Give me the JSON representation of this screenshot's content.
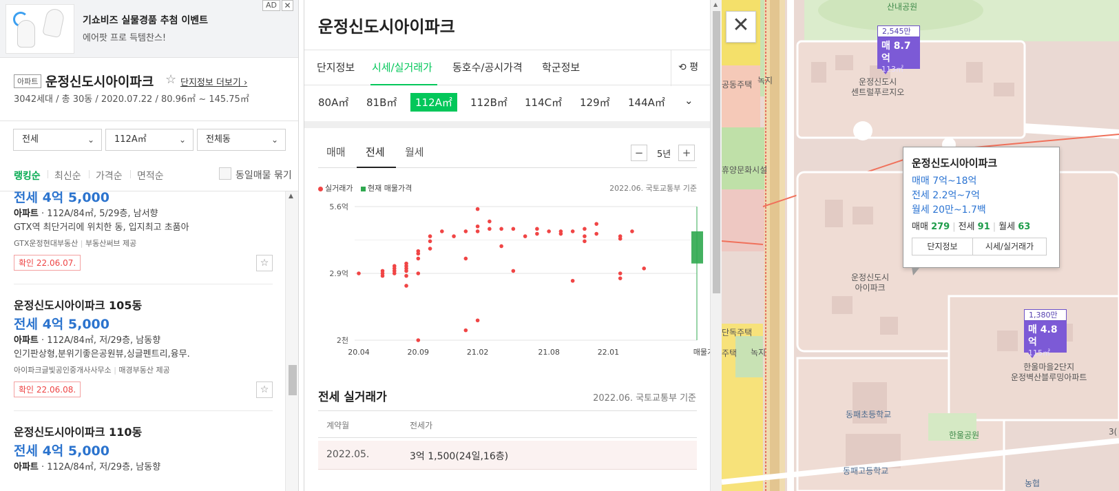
{
  "ad": {
    "title": "기쇼비즈 실물경품 추첨 이벤트",
    "subtitle": "에어팟 프로 득템찬스!",
    "badge": "AD",
    "close": "✕"
  },
  "complex": {
    "type": "아파트",
    "name": "운정신도시아이파크",
    "more_link": "단지정보 더보기",
    "meta": "3042세대 / 총 30동 / 2020.07.22 / 80.96㎡ ~ 145.75㎡"
  },
  "filters": {
    "trade": "전세",
    "area": "112A㎡",
    "dong": "전체동"
  },
  "sort": {
    "items": [
      "랭킹순",
      "최신순",
      "가격순",
      "면적순"
    ],
    "group_label": "동일매물 묶기"
  },
  "listings": [
    {
      "name": "",
      "price": "전세 4억 5,000",
      "type": "아파트",
      "spec": "112A/84㎡, 5/29층, 남서향",
      "desc": "GTX역 최단거리에 위치한 동, 입지최고 초품아",
      "agent": "GTX운정현대부동산",
      "provider": "부동산써브 제공",
      "confirm": "확인 22.06.07."
    },
    {
      "name": "운정신도시아이파크 105동",
      "price": "전세 4억 5,000",
      "type": "아파트",
      "spec": "112A/84㎡, 저/29층, 남동향",
      "desc": "인기판상형,분위기좋은공원뷰,싱글펜트리,융무.",
      "agent": "아이파크글빛공인중개사사무소",
      "provider": "매경부동산 제공",
      "confirm": "확인 22.06.08."
    },
    {
      "name": "운정신도시아이파크 110동",
      "price": "전세 4억 5,000",
      "type": "아파트",
      "spec": "112A/84㎡, 저/29층, 남동향"
    }
  ],
  "detail": {
    "title": "운정신도시아이파크",
    "tabs": [
      "단지정보",
      "시세/실거래가",
      "동호수/공시가격",
      "학군정보"
    ],
    "py_button": "평",
    "sizes": [
      "80A㎡",
      "81B㎡",
      "112A㎡",
      "112B㎡",
      "114C㎡",
      "129㎡",
      "144A㎡"
    ],
    "subtabs": [
      "매매",
      "전세",
      "월세"
    ],
    "period": "5년",
    "legend_actual": "실거래가",
    "legend_current": "현재 매물가격",
    "basis": "2022.06. 국토교통부 기준",
    "table_title": "전세 실거래가",
    "table_headers": [
      "계약월",
      "전세가"
    ],
    "table_rows": [
      {
        "month": "2022.05.",
        "price": "3억 1,500(24일,16층)"
      }
    ]
  },
  "chart_data": {
    "type": "scatter",
    "title": "",
    "xlabel": "",
    "ylabel": "",
    "y_tick_labels": [
      "5.6억",
      "2.9억",
      "2천"
    ],
    "y_ticks": [
      5.6,
      2.9,
      0.2
    ],
    "ylim": [
      0.2,
      5.6
    ],
    "x_tick_labels": [
      "20.04",
      "20.09",
      "21.02",
      "21.08",
      "22.01",
      "매물가격"
    ],
    "x_ticks": [
      "2020-04",
      "2020-09",
      "2021-02",
      "2021-08",
      "2022-01"
    ],
    "xlim": [
      "2020-04",
      "2022-07"
    ],
    "series": [
      {
        "name": "실거래가",
        "color": "#f04545",
        "points": [
          [
            "2020-04",
            2.9
          ],
          [
            "2020-06",
            2.9
          ],
          [
            "2020-06",
            2.8
          ],
          [
            "2020-06",
            3.0
          ],
          [
            "2020-07",
            3.0
          ],
          [
            "2020-07",
            2.9
          ],
          [
            "2020-07",
            3.2
          ],
          [
            "2020-07",
            3.1
          ],
          [
            "2020-08",
            2.8
          ],
          [
            "2020-08",
            3.0
          ],
          [
            "2020-08",
            3.3
          ],
          [
            "2020-08",
            2.4
          ],
          [
            "2020-08",
            3.1
          ],
          [
            "2020-08",
            3.2
          ],
          [
            "2020-09",
            3.5
          ],
          [
            "2020-09",
            3.7
          ],
          [
            "2020-09",
            3.8
          ],
          [
            "2020-09",
            2.9
          ],
          [
            "2020-10",
            4.2
          ],
          [
            "2020-10",
            4.4
          ],
          [
            "2020-10",
            3.9
          ],
          [
            "2020-11",
            4.6
          ],
          [
            "2020-12",
            4.4
          ],
          [
            "2021-01",
            4.6
          ],
          [
            "2021-01",
            3.5
          ],
          [
            "2021-02",
            4.8
          ],
          [
            "2021-02",
            4.6
          ],
          [
            "2021-02",
            5.5
          ],
          [
            "2021-03",
            4.7
          ],
          [
            "2021-03",
            5.0
          ],
          [
            "2021-04",
            4.7
          ],
          [
            "2021-04",
            4.0
          ],
          [
            "2021-05",
            4.7
          ],
          [
            "2021-05",
            3.0
          ],
          [
            "2021-06",
            4.4
          ],
          [
            "2021-07",
            4.7
          ],
          [
            "2021-07",
            4.5
          ],
          [
            "2021-08",
            4.6
          ],
          [
            "2021-09",
            4.6
          ],
          [
            "2021-09",
            4.5
          ],
          [
            "2021-10",
            4.6
          ],
          [
            "2021-10",
            2.6
          ],
          [
            "2021-11",
            4.7
          ],
          [
            "2021-11",
            4.4
          ],
          [
            "2021-11",
            4.2
          ],
          [
            "2021-12",
            4.5
          ],
          [
            "2021-12",
            4.9
          ],
          [
            "2022-02",
            4.4
          ],
          [
            "2022-02",
            4.3
          ],
          [
            "2022-02",
            2.9
          ],
          [
            "2022-02",
            2.7
          ],
          [
            "2022-03",
            4.6
          ],
          [
            "2022-04",
            3.1
          ],
          [
            "2020-09",
            0.2
          ],
          [
            "2021-01",
            0.6
          ],
          [
            "2021-02",
            1.0
          ]
        ]
      }
    ],
    "current_listing": {
      "name": "현재 매물가격",
      "color": "#2fa84f",
      "low": 3.3,
      "high": 4.6
    },
    "grid": true
  },
  "map": {
    "close": "✕",
    "labels": [
      {
        "text": "산내공원",
        "style": "green"
      },
      {
        "text": "운정신도시\n센트럴푸르지오",
        "style": ""
      },
      {
        "text": "공동주택",
        "style": ""
      },
      {
        "text": "녹지",
        "style": ""
      },
      {
        "text": "휴양문화시설",
        "style": ""
      },
      {
        "text": "운정신도시\n아이파크",
        "style": ""
      },
      {
        "text": "단독주택",
        "style": ""
      },
      {
        "text": "주택",
        "style": ""
      },
      {
        "text": "녹지",
        "style": ""
      },
      {
        "text": "한울마을2단지\n운정벽산블루밍아파트",
        "style": ""
      },
      {
        "text": "동패초등학교",
        "style": "blue"
      },
      {
        "text": "한울공원",
        "style": "green"
      },
      {
        "text": "동패고등학교",
        "style": "blue"
      },
      {
        "text": "농협",
        "style": "blue"
      },
      {
        "text": "3(",
        "style": ""
      }
    ],
    "markers": [
      {
        "count": "2,545만",
        "price": "매 8.7억",
        "area": "113㎡"
      },
      {
        "count": "1,380만",
        "price": "매 4.8억",
        "area": "115㎡"
      }
    ],
    "popup": {
      "title": "운정신도시아이파크",
      "sale": "매매 7억~18억",
      "jeonse": "전세 2.2억~7억",
      "monthly": "월세 20만~1.7백",
      "counts": [
        {
          "label": "매매",
          "value": "279"
        },
        {
          "label": "전세",
          "value": "91"
        },
        {
          "label": "월세",
          "value": "63"
        }
      ],
      "buttons": [
        "단지정보",
        "시세/실거래가"
      ]
    }
  }
}
